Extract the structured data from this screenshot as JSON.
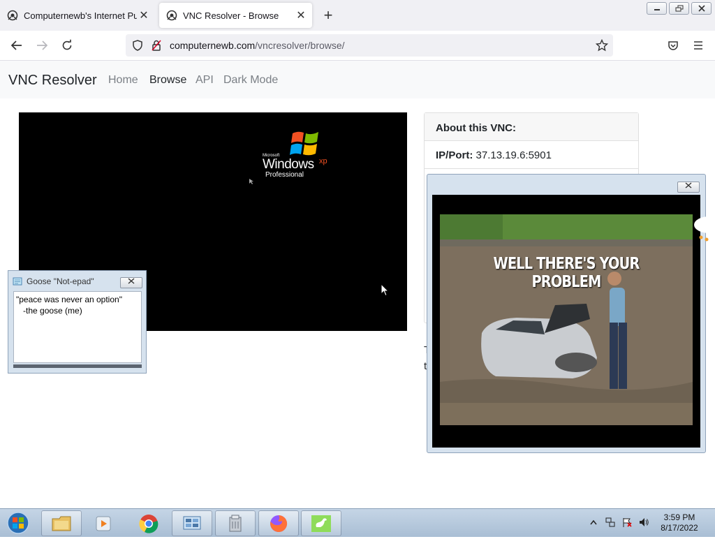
{
  "browser": {
    "tabs": [
      {
        "title": "Computernewb's Internet Pub",
        "close": "✕",
        "active": false
      },
      {
        "title": "VNC Resolver - Browse",
        "close": "✕",
        "active": true
      }
    ],
    "new_tab": "+",
    "url_domain": "computernewb.com",
    "url_path": "/vncresolver/browse/"
  },
  "site": {
    "brand": "VNC Resolver",
    "nav": [
      "Home",
      "Browse",
      "API",
      "Dark Mode"
    ],
    "current_nav": "Browse"
  },
  "vnc_screen": {
    "logo_small": "Microsoft",
    "logo_windows": "Windows",
    "logo_xp": "xp",
    "logo_edition": "Professional"
  },
  "about": {
    "header": "About this VNC:",
    "ip_label": "IP/Port:",
    "ip_value": "37.13.19.6:5901"
  },
  "notepad": {
    "title": "Goose \"Not-epad\"",
    "text": "\"peace was never an option\"\n   -the goose (me)"
  },
  "meme": {
    "caption": "WELL THERE'S YOUR PROBLEM"
  },
  "cutoff_text": {
    "line1": "T",
    "line2": "t"
  },
  "taskbar": {
    "time": "3:59 PM",
    "date": "8/17/2022"
  },
  "colors": {
    "page_bg": "#ffffff",
    "navbar_bg": "#f8f9fa",
    "taskbar": "#b5c8dc",
    "vnc_bg": "#000000"
  }
}
